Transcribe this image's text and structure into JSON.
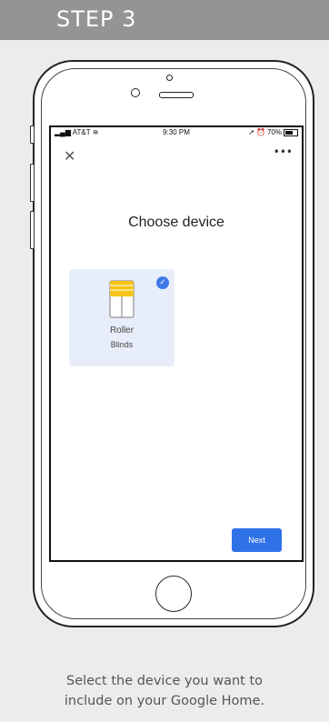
{
  "header": {
    "step_label": "STEP 3"
  },
  "status_bar": {
    "carrier": "AT&T",
    "time": "9:30 PM",
    "battery": "70%"
  },
  "screen": {
    "close_icon": "close-icon",
    "more_icon": "more-options-icon",
    "title": "Choose device",
    "device": {
      "line1": "Roller",
      "line2": "Blinds",
      "selected": true,
      "icon": "roller-blinds-icon"
    },
    "next_label": "Next"
  },
  "caption": {
    "line1": "Select the device you want to",
    "line2": "include on your Google Home."
  },
  "colors": {
    "header": "#949494",
    "accent": "#2f72e8",
    "card": "#e8eef9",
    "background": "#ececec"
  }
}
